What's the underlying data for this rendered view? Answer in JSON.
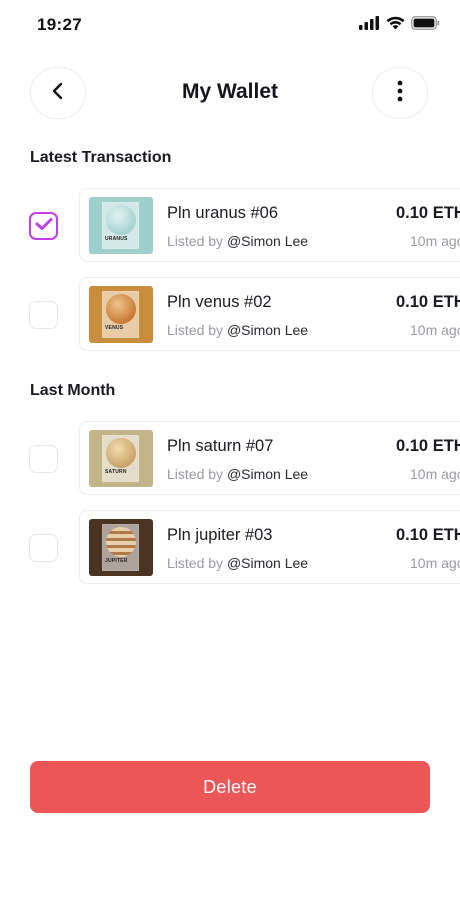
{
  "status_bar": {
    "time": "19:27",
    "icons": [
      "cellular-signal-icon",
      "wifi-icon",
      "battery-icon"
    ]
  },
  "header": {
    "title": "My Wallet",
    "back_icon": "chevron-left-icon",
    "menu_icon": "more-vertical-icon"
  },
  "sections": [
    {
      "title": "Latest Transaction",
      "items": [
        {
          "name": "Pln uranus #06",
          "listed_prefix": "Listed by",
          "user": "@Simon Lee",
          "price": "0.10 ETH",
          "time": "10m ago",
          "checked": true,
          "thumb_label": "URANUS",
          "thumb_bg": "#9fcfcb",
          "planet_color": "#bfe2e2"
        },
        {
          "name": "Pln venus #02",
          "listed_prefix": "Listed by",
          "user": "@Simon Lee",
          "price": "0.10 ETH",
          "time": "10m ago",
          "checked": false,
          "thumb_label": "VENUS",
          "thumb_bg": "#c98e3c",
          "planet_color": "#d1843f"
        }
      ]
    },
    {
      "title": "Last Month",
      "items": [
        {
          "name": "Pln saturn #07",
          "listed_prefix": "Listed by",
          "user": "@Simon Lee",
          "price": "0.10 ETH",
          "time": "10m ago",
          "checked": false,
          "thumb_label": "SATURN",
          "thumb_bg": "#c4b48a",
          "planet_color": "#d9b87a"
        },
        {
          "name": "Pln jupiter #03",
          "listed_prefix": "Listed by",
          "user": "@Simon Lee",
          "price": "0.10 ETH",
          "time": "10m ago",
          "checked": false,
          "thumb_label": "JUPITER",
          "thumb_bg": "#4a3320",
          "planet_color": "#c99a6b"
        }
      ]
    }
  ],
  "delete_label": "Delete",
  "colors": {
    "accent": "#c33ee6",
    "delete": "#ec5656",
    "muted_text": "#9a9aa3"
  }
}
